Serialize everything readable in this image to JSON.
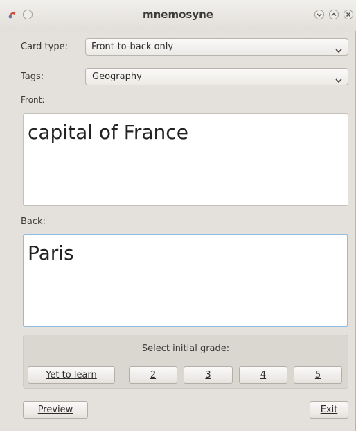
{
  "window": {
    "title": "mnemosyne"
  },
  "card_type": {
    "label": "Card type:",
    "value": "Front-to-back only"
  },
  "tags": {
    "label": "Tags:",
    "value": "Geography"
  },
  "front": {
    "label": "Front:",
    "text": "capital of France"
  },
  "back": {
    "label": "Back:",
    "text": "Paris"
  },
  "grade": {
    "caption": "Select initial grade:",
    "buttons": [
      "Yet to learn",
      "2",
      "3",
      "4",
      "5"
    ]
  },
  "actions": {
    "preview": "Preview",
    "exit": "Exit"
  },
  "icons": {
    "app": "app-menu-icon",
    "pin": "pin-icon",
    "minimize": "minimize-icon",
    "maximize": "maximize-icon",
    "close": "close-icon"
  }
}
